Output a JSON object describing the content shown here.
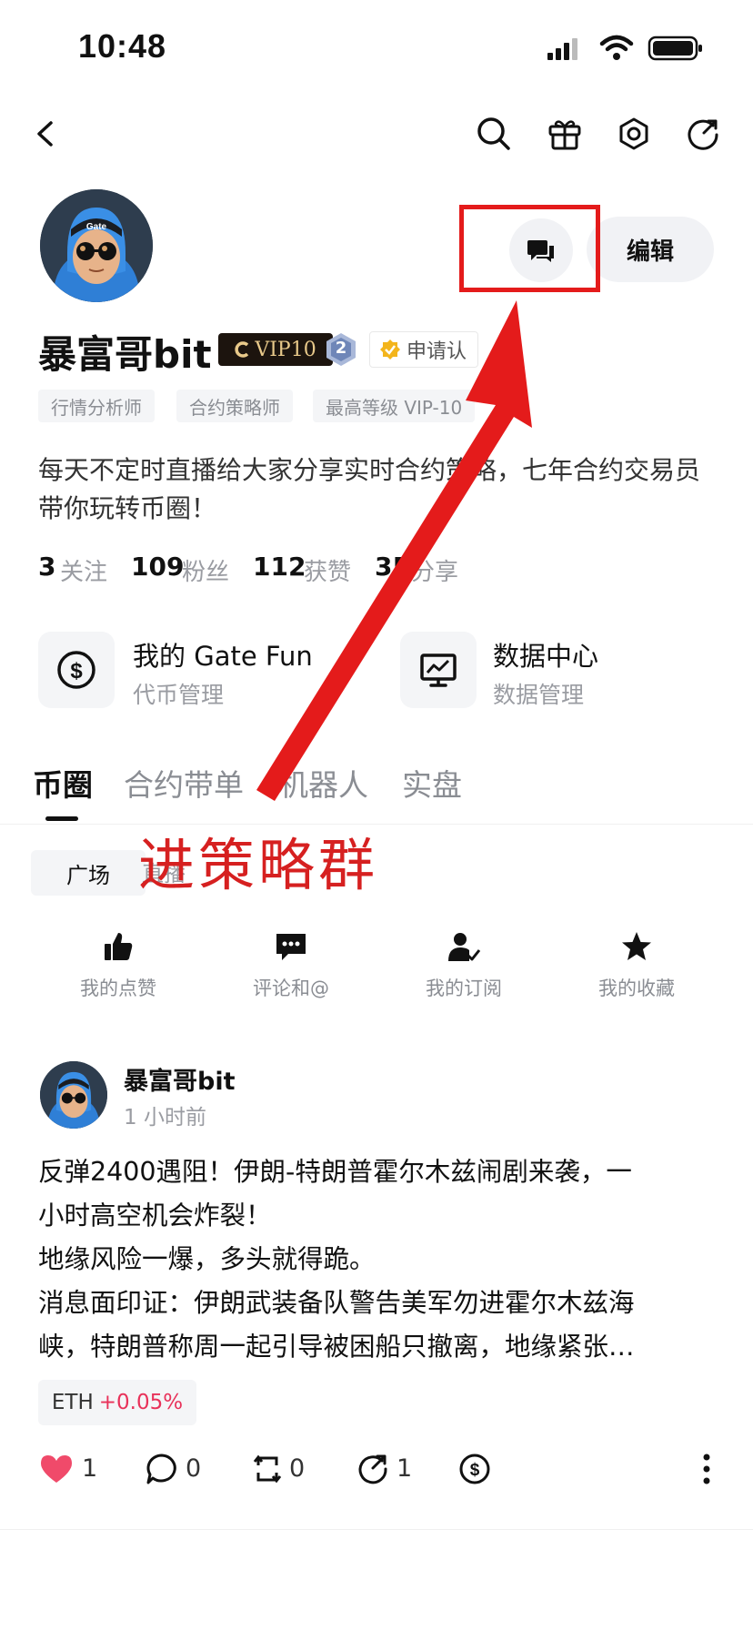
{
  "status_bar": {
    "time": "10:48"
  },
  "profile": {
    "name": "暴富哥bit",
    "vip": "VIP10",
    "level": "2",
    "apply_label": "申请认",
    "edit_label": "编辑",
    "tags": [
      "行情分析师",
      "合约策略师",
      "最高等级 VIP-10"
    ],
    "bio": "每天不定时直播给大家分享实时合约策略，七年合约交易员带你玩转币圈！",
    "stats": [
      {
        "num": "3",
        "label": "关注"
      },
      {
        "num": "109",
        "label": "粉丝"
      },
      {
        "num": "112",
        "label": "获赞"
      },
      {
        "num": "35",
        "label": "分享"
      }
    ]
  },
  "cards": [
    {
      "title": "我的 Gate Fun",
      "subtitle": "代币管理",
      "icon": "dollar-coin-icon"
    },
    {
      "title": "数据中心",
      "subtitle": "数据管理",
      "icon": "chart-monitor-icon"
    }
  ],
  "tabs": [
    "币圈",
    "合约带单",
    "机器人",
    "实盘"
  ],
  "sub_tabs": [
    "广场",
    "直播"
  ],
  "annotation": "进策略群",
  "actions": [
    {
      "label": "我的点赞",
      "icon": "thumbs-up-icon"
    },
    {
      "label": "评论和@",
      "icon": "comment-icon"
    },
    {
      "label": "我的订阅",
      "icon": "subscribe-icon"
    },
    {
      "label": "我的收藏",
      "icon": "star-icon"
    }
  ],
  "post": {
    "author": "暴富哥bit",
    "time": "1 小时前",
    "lines": [
      "反弹2400遇阻！伊朗-特朗普霍尔木兹闹剧来袭，一",
      "小时高空机会炸裂！",
      "地缘风险一爆，多头就得跪。",
      "消息面印证：伊朗武装备队警告美军勿进霍尔木兹海",
      "峡，特朗普称周一起引导被困船只撤离，地缘紧张…"
    ],
    "ticker": "ETH",
    "ticker_change": "+0.05%",
    "likes": "1",
    "comments": "0",
    "reposts": "0",
    "shares": "1"
  },
  "colors": {
    "accent_red": "#e41b1b",
    "change_pink": "#e8325a",
    "like_red": "#f04a6a"
  }
}
